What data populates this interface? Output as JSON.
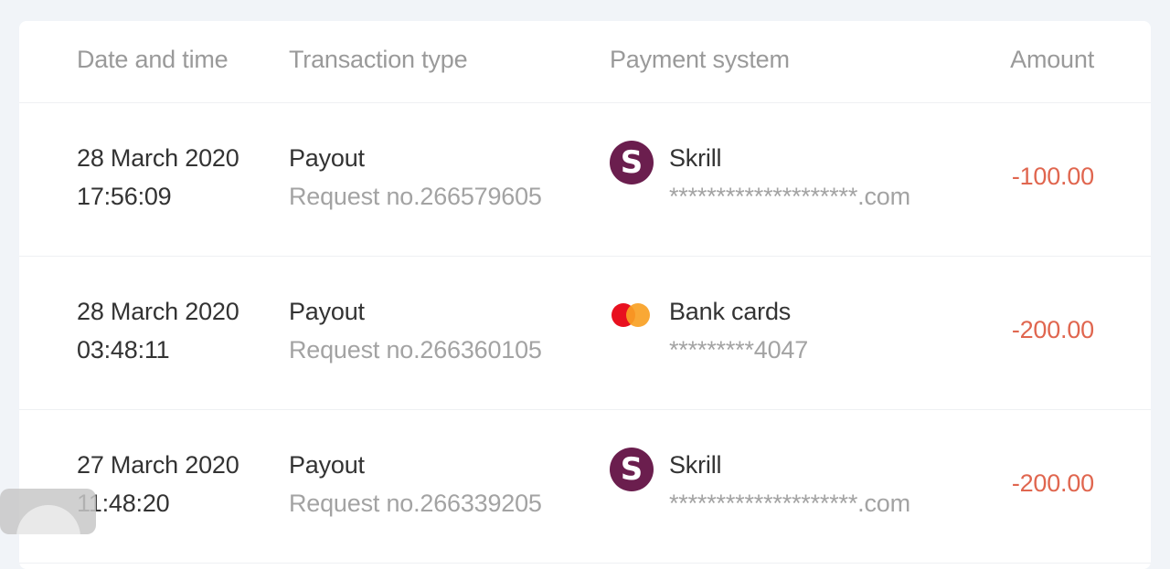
{
  "table": {
    "columns": {
      "date": "Date and time",
      "type": "Transaction type",
      "system": "Payment system",
      "amount": "Amount"
    },
    "rows": [
      {
        "date": "28 March 2020",
        "time": "17:56:09",
        "type": "Payout",
        "request": "Request no.266579605",
        "system_icon": "skrill-icon",
        "system_icon_glyph": "S",
        "system": "Skrill",
        "account": "********************.com",
        "amount": "-100.00"
      },
      {
        "date": "28 March 2020",
        "time": "03:48:11",
        "type": "Payout",
        "request": "Request no.266360105",
        "system_icon": "mastercard-icon",
        "system": "Bank cards",
        "account": "*********4047",
        "amount": "-200.00"
      },
      {
        "date": "27 March 2020",
        "time": "11:48:20",
        "type": "Payout",
        "request": "Request no.266339205",
        "system_icon": "skrill-icon",
        "system_icon_glyph": "S",
        "system": "Skrill",
        "account": "********************.com",
        "amount": "-200.00"
      }
    ]
  },
  "colors": {
    "negative_amount": "#e0664f",
    "skrill_brand": "#6b1e4e",
    "mastercard_red": "#e8101f",
    "mastercard_orange": "#f8a124"
  }
}
